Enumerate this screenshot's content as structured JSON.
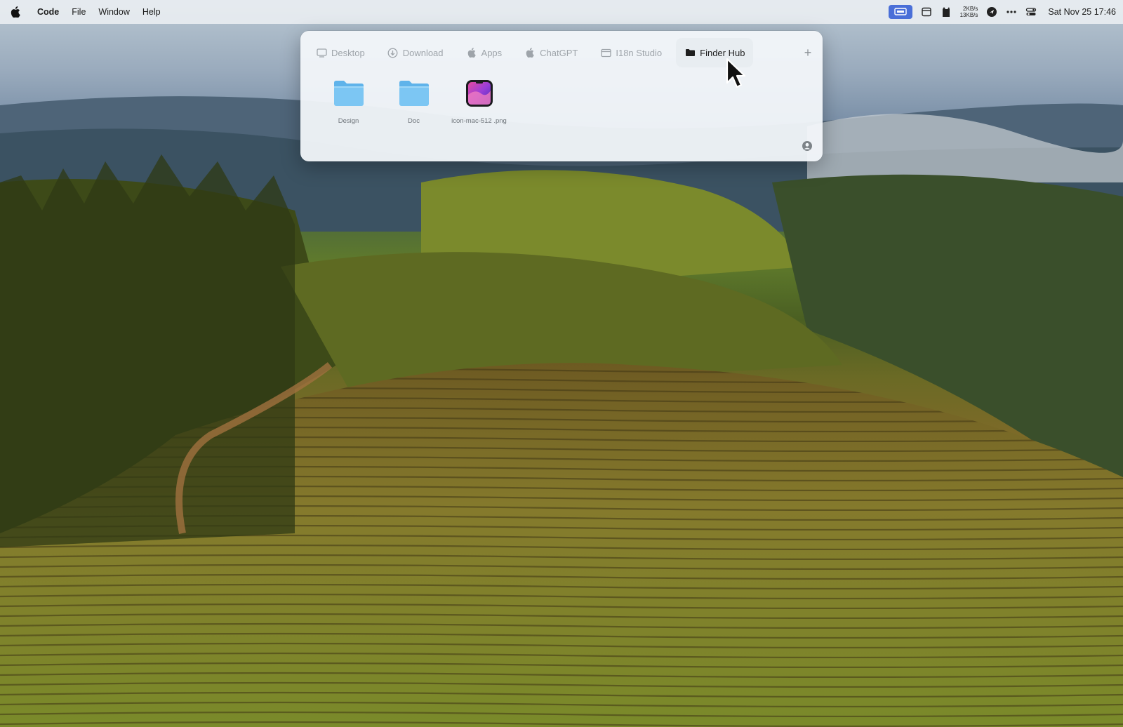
{
  "menubar": {
    "app_name": "Code",
    "menus": [
      "File",
      "Window",
      "Help"
    ],
    "net_up": "2KB/s",
    "net_down": "13KB/s",
    "datetime": "Sat Nov 25  17:46",
    "tray_icons": [
      "screen-share-icon",
      "calendar-icon",
      "cat-icon",
      "network-speed",
      "navigation-icon",
      "more-icon",
      "control-center-icon"
    ],
    "accent_color": "#4a6fd8"
  },
  "panel": {
    "tabs": [
      {
        "label": "Desktop",
        "icon": "desktop-icon",
        "active": false
      },
      {
        "label": "Download",
        "icon": "download-icon",
        "active": false
      },
      {
        "label": "Apps",
        "icon": "apple-icon",
        "active": false
      },
      {
        "label": "ChatGPT",
        "icon": "apple-icon",
        "active": false
      },
      {
        "label": "I18n Studio",
        "icon": "window-icon",
        "active": false
      },
      {
        "label": "Finder Hub",
        "icon": "folder-icon",
        "active": true
      }
    ],
    "add_tab": "+",
    "files": [
      {
        "name": "Design",
        "kind": "folder"
      },
      {
        "name": "Doc",
        "kind": "folder"
      },
      {
        "name": "icon-mac-512 .png",
        "kind": "image"
      }
    ]
  }
}
